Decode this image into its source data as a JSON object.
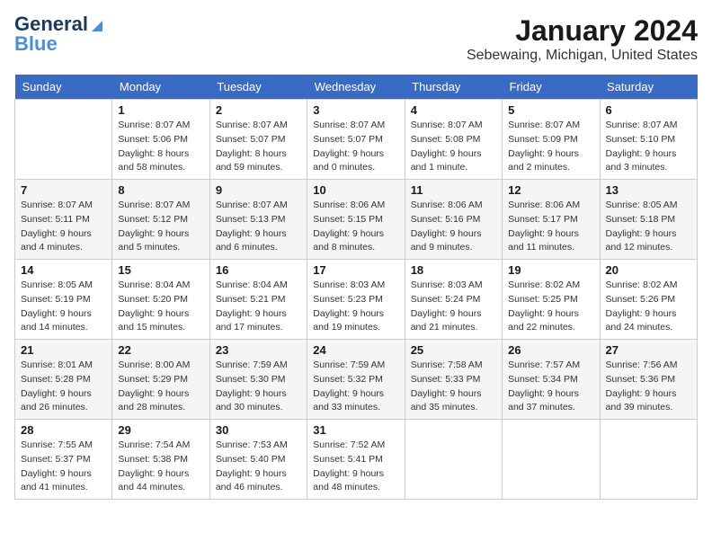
{
  "header": {
    "logo_line1": "General",
    "logo_line2": "Blue",
    "month": "January 2024",
    "location": "Sebewaing, Michigan, United States"
  },
  "weekdays": [
    "Sunday",
    "Monday",
    "Tuesday",
    "Wednesday",
    "Thursday",
    "Friday",
    "Saturday"
  ],
  "weeks": [
    [
      {
        "day": "",
        "info": ""
      },
      {
        "day": "1",
        "info": "Sunrise: 8:07 AM\nSunset: 5:06 PM\nDaylight: 8 hours\nand 58 minutes."
      },
      {
        "day": "2",
        "info": "Sunrise: 8:07 AM\nSunset: 5:07 PM\nDaylight: 8 hours\nand 59 minutes."
      },
      {
        "day": "3",
        "info": "Sunrise: 8:07 AM\nSunset: 5:07 PM\nDaylight: 9 hours\nand 0 minutes."
      },
      {
        "day": "4",
        "info": "Sunrise: 8:07 AM\nSunset: 5:08 PM\nDaylight: 9 hours\nand 1 minute."
      },
      {
        "day": "5",
        "info": "Sunrise: 8:07 AM\nSunset: 5:09 PM\nDaylight: 9 hours\nand 2 minutes."
      },
      {
        "day": "6",
        "info": "Sunrise: 8:07 AM\nSunset: 5:10 PM\nDaylight: 9 hours\nand 3 minutes."
      }
    ],
    [
      {
        "day": "7",
        "info": "Sunrise: 8:07 AM\nSunset: 5:11 PM\nDaylight: 9 hours\nand 4 minutes."
      },
      {
        "day": "8",
        "info": "Sunrise: 8:07 AM\nSunset: 5:12 PM\nDaylight: 9 hours\nand 5 minutes."
      },
      {
        "day": "9",
        "info": "Sunrise: 8:07 AM\nSunset: 5:13 PM\nDaylight: 9 hours\nand 6 minutes."
      },
      {
        "day": "10",
        "info": "Sunrise: 8:06 AM\nSunset: 5:15 PM\nDaylight: 9 hours\nand 8 minutes."
      },
      {
        "day": "11",
        "info": "Sunrise: 8:06 AM\nSunset: 5:16 PM\nDaylight: 9 hours\nand 9 minutes."
      },
      {
        "day": "12",
        "info": "Sunrise: 8:06 AM\nSunset: 5:17 PM\nDaylight: 9 hours\nand 11 minutes."
      },
      {
        "day": "13",
        "info": "Sunrise: 8:05 AM\nSunset: 5:18 PM\nDaylight: 9 hours\nand 12 minutes."
      }
    ],
    [
      {
        "day": "14",
        "info": "Sunrise: 8:05 AM\nSunset: 5:19 PM\nDaylight: 9 hours\nand 14 minutes."
      },
      {
        "day": "15",
        "info": "Sunrise: 8:04 AM\nSunset: 5:20 PM\nDaylight: 9 hours\nand 15 minutes."
      },
      {
        "day": "16",
        "info": "Sunrise: 8:04 AM\nSunset: 5:21 PM\nDaylight: 9 hours\nand 17 minutes."
      },
      {
        "day": "17",
        "info": "Sunrise: 8:03 AM\nSunset: 5:23 PM\nDaylight: 9 hours\nand 19 minutes."
      },
      {
        "day": "18",
        "info": "Sunrise: 8:03 AM\nSunset: 5:24 PM\nDaylight: 9 hours\nand 21 minutes."
      },
      {
        "day": "19",
        "info": "Sunrise: 8:02 AM\nSunset: 5:25 PM\nDaylight: 9 hours\nand 22 minutes."
      },
      {
        "day": "20",
        "info": "Sunrise: 8:02 AM\nSunset: 5:26 PM\nDaylight: 9 hours\nand 24 minutes."
      }
    ],
    [
      {
        "day": "21",
        "info": "Sunrise: 8:01 AM\nSunset: 5:28 PM\nDaylight: 9 hours\nand 26 minutes."
      },
      {
        "day": "22",
        "info": "Sunrise: 8:00 AM\nSunset: 5:29 PM\nDaylight: 9 hours\nand 28 minutes."
      },
      {
        "day": "23",
        "info": "Sunrise: 7:59 AM\nSunset: 5:30 PM\nDaylight: 9 hours\nand 30 minutes."
      },
      {
        "day": "24",
        "info": "Sunrise: 7:59 AM\nSunset: 5:32 PM\nDaylight: 9 hours\nand 33 minutes."
      },
      {
        "day": "25",
        "info": "Sunrise: 7:58 AM\nSunset: 5:33 PM\nDaylight: 9 hours\nand 35 minutes."
      },
      {
        "day": "26",
        "info": "Sunrise: 7:57 AM\nSunset: 5:34 PM\nDaylight: 9 hours\nand 37 minutes."
      },
      {
        "day": "27",
        "info": "Sunrise: 7:56 AM\nSunset: 5:36 PM\nDaylight: 9 hours\nand 39 minutes."
      }
    ],
    [
      {
        "day": "28",
        "info": "Sunrise: 7:55 AM\nSunset: 5:37 PM\nDaylight: 9 hours\nand 41 minutes."
      },
      {
        "day": "29",
        "info": "Sunrise: 7:54 AM\nSunset: 5:38 PM\nDaylight: 9 hours\nand 44 minutes."
      },
      {
        "day": "30",
        "info": "Sunrise: 7:53 AM\nSunset: 5:40 PM\nDaylight: 9 hours\nand 46 minutes."
      },
      {
        "day": "31",
        "info": "Sunrise: 7:52 AM\nSunset: 5:41 PM\nDaylight: 9 hours\nand 48 minutes."
      },
      {
        "day": "",
        "info": ""
      },
      {
        "day": "",
        "info": ""
      },
      {
        "day": "",
        "info": ""
      }
    ]
  ]
}
